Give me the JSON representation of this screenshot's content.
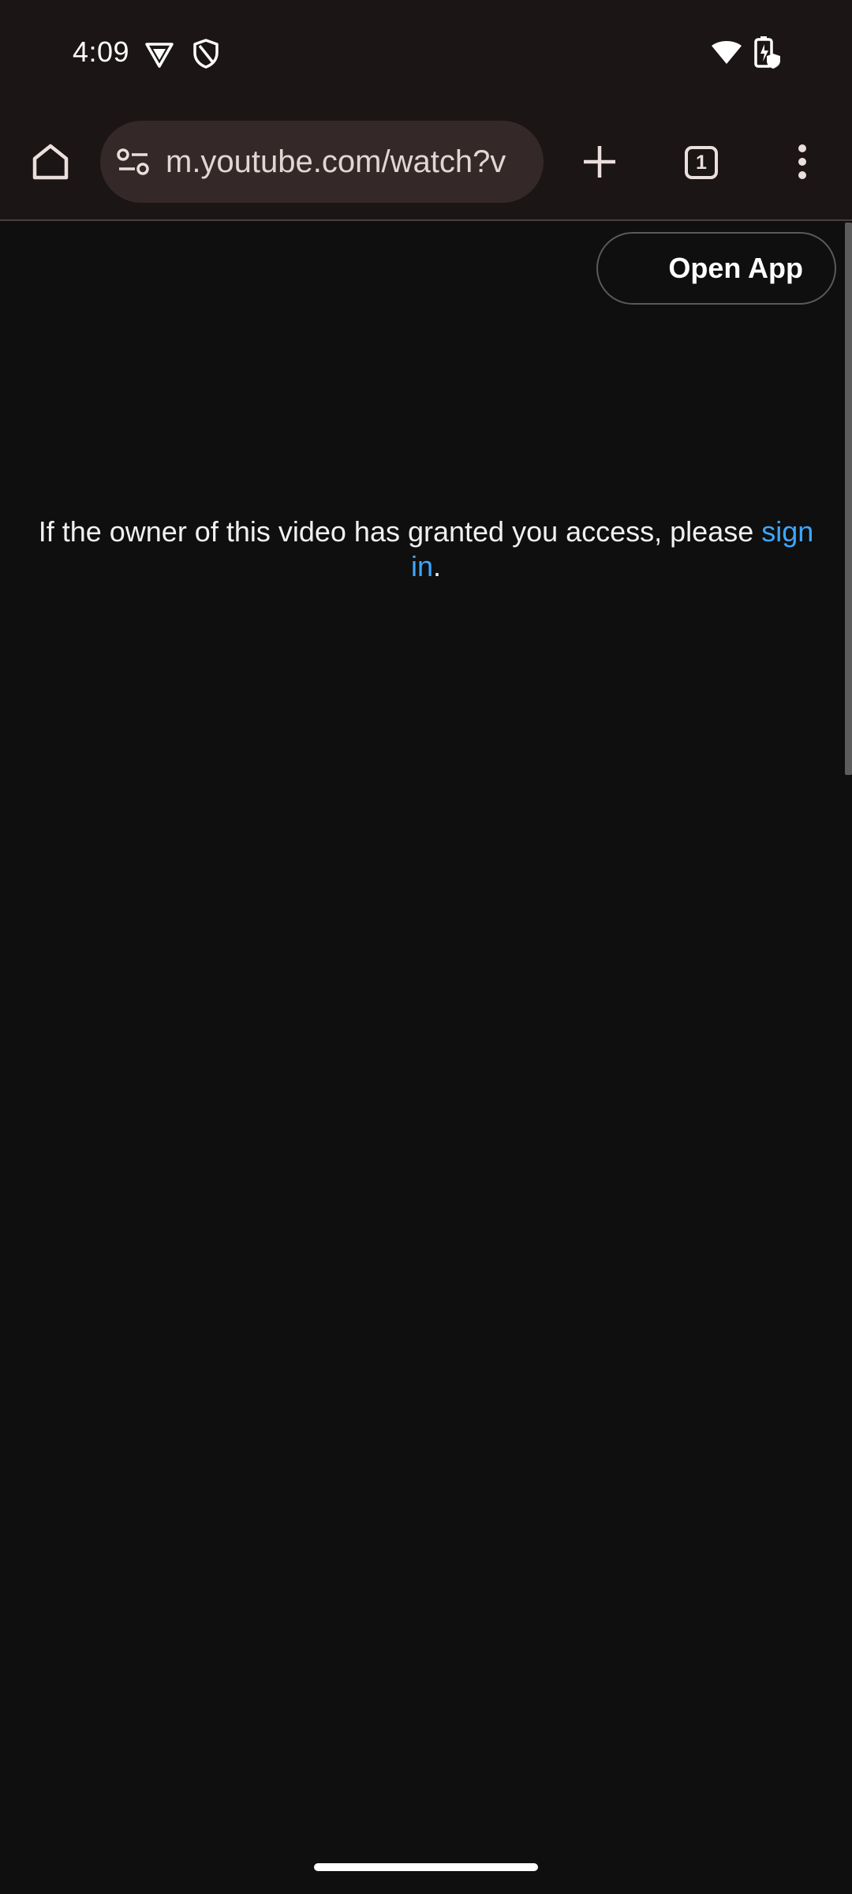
{
  "status_bar": {
    "time": "4:09",
    "left_icons": [
      "vpn-shield-icon",
      "shield-icon"
    ],
    "right_icons": [
      "wifi-icon",
      "battery-saver-icon"
    ]
  },
  "toolbar": {
    "url": "m.youtube.com/watch?v",
    "tab_count": "1",
    "icons": [
      "home-icon",
      "site-settings-icon",
      "new-tab-icon",
      "tab-switcher-icon",
      "overflow-menu-icon"
    ]
  },
  "page": {
    "open_app_label": "Open App",
    "message_prefix": "If the owner of this video has granted you access, please ",
    "sign_in_label": "sign in",
    "message_suffix": "."
  },
  "colors": {
    "chrome_bar": "#1b1515",
    "omnibox": "#342828",
    "page_bg": "#0f0f0f",
    "link": "#3ea6ff"
  }
}
